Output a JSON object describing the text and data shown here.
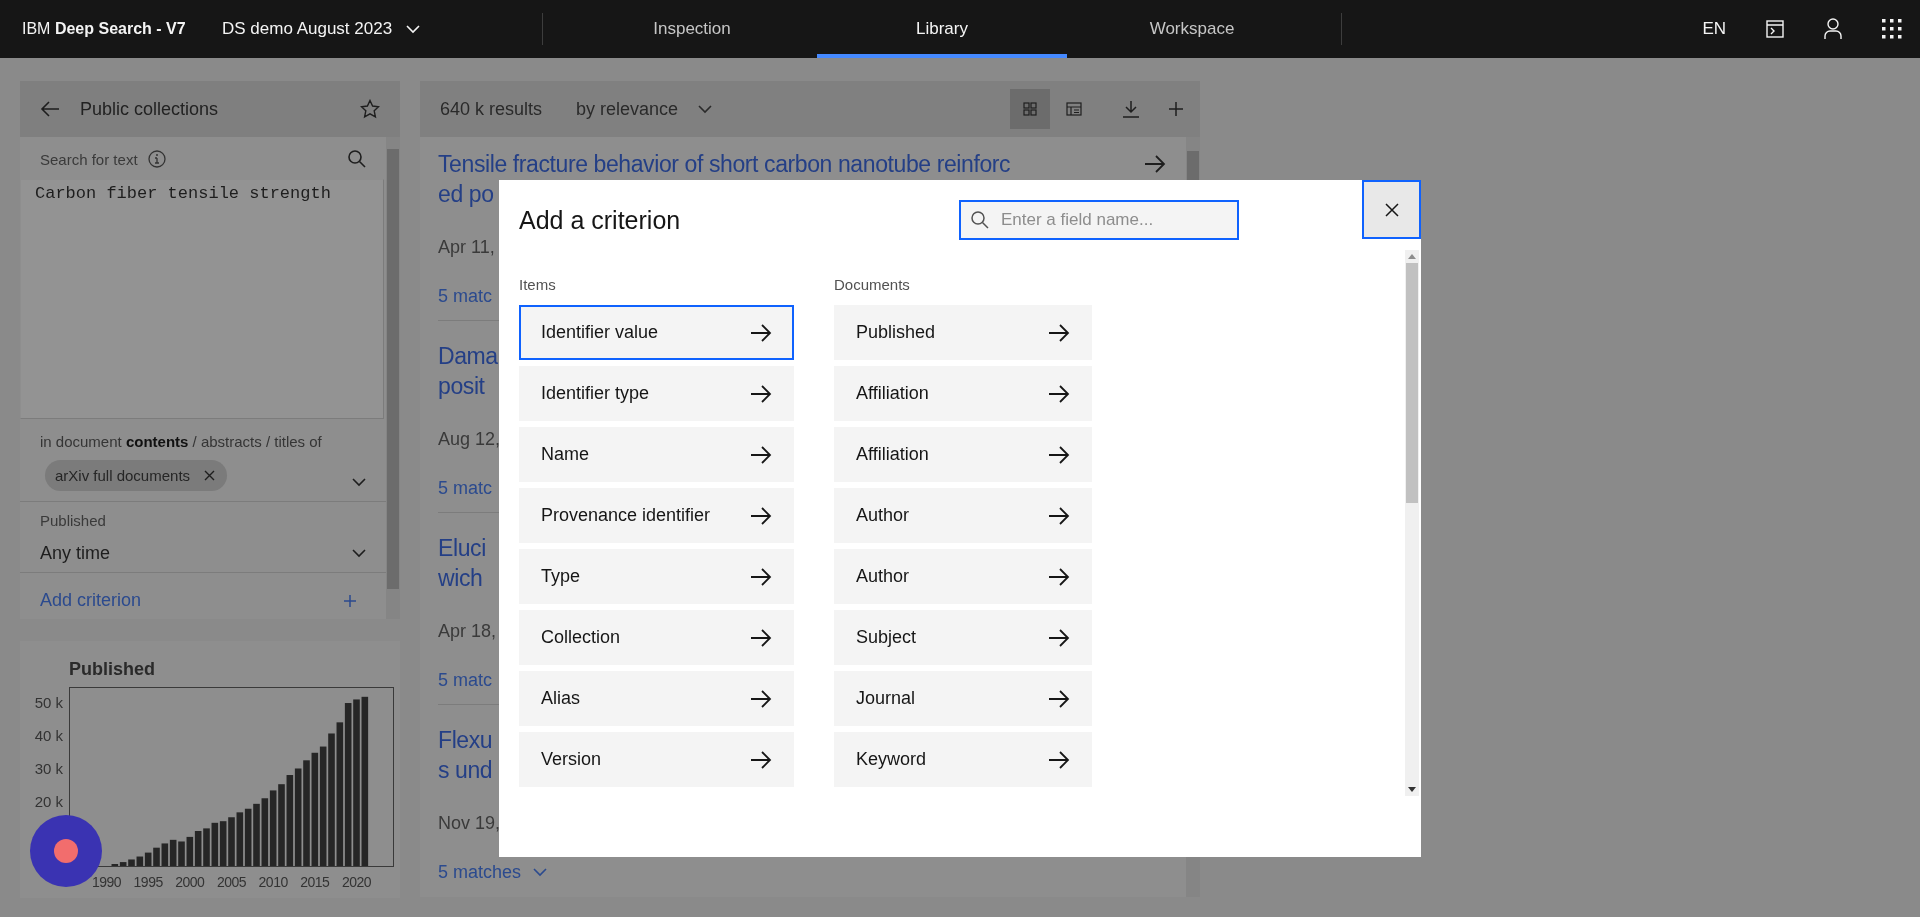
{
  "top_bar": {
    "brand": "IBM **Deep Search - V7**",
    "project": "DS demo August 2023",
    "tabs": [
      {
        "label": "Inspection",
        "selected": false
      },
      {
        "label": "Library",
        "selected": true
      },
      {
        "label": "Workspace",
        "selected": false
      }
    ],
    "language": "EN"
  },
  "collections_panel": {
    "title": "Public collections",
    "search_label": "Search for text",
    "query": "Carbon fiber tensile strength",
    "scope": "in document **contents** / abstracts / titles of",
    "collection_tag": "arXiv full documents",
    "published_label": "Published",
    "published_value": "Any time",
    "add_criterion": "Add criterion"
  },
  "published_chart": {
    "chart_data": {
      "type": "bar",
      "title": "Published",
      "x": [
        1991,
        1992,
        1993,
        1994,
        1995,
        1996,
        1997,
        1998,
        1999,
        2000,
        2001,
        2002,
        2003,
        2004,
        2005,
        2006,
        2007,
        2008,
        2009,
        2010,
        2011,
        2012,
        2013,
        2014,
        2015,
        2016,
        2017,
        2018,
        2019,
        2020,
        2021
      ],
      "series": [
        {
          "color": "#262626",
          "values": [
            400,
            1500,
            2300,
            3200,
            4400,
            5900,
            7200,
            8300,
            7800,
            9200,
            11000,
            11800,
            13500,
            14000,
            15200,
            16700,
            17800,
            19300,
            21000,
            23400,
            25300,
            28100,
            30100,
            32600,
            34900,
            36800,
            40800,
            44200,
            50100,
            51200,
            52000
          ]
        }
      ],
      "xlim": [
        1985.5,
        2024.5
      ],
      "ylim": [
        0,
        55000
      ],
      "xticks": [
        1990,
        1995,
        2000,
        2005,
        2010,
        2015,
        2020
      ],
      "yticks": [
        {
          "value": 20000,
          "label": "20 k"
        },
        {
          "value": 30000,
          "label": "30 k"
        },
        {
          "value": 40000,
          "label": "40 k"
        },
        {
          "value": 50000,
          "label": "50 k"
        }
      ]
    }
  },
  "results": {
    "count": "640 k results",
    "sort": "by relevance",
    "views": [
      {
        "kind": "grid",
        "selected": true
      },
      {
        "kind": "table",
        "selected": false
      }
    ],
    "entries": [
      {
        "title_lines": [
          "Tensile fracture behavior of short carbon nanotube reinforc",
          "ed po"
        ],
        "date": "Apr 11,",
        "matches": "5 matc",
        "caret": false
      },
      {
        "title_lines": [
          "Dama",
          "posit"
        ],
        "date": "Aug 12,",
        "matches": "5 matc",
        "caret": false
      },
      {
        "title_lines": [
          "Eluci",
          "wich"
        ],
        "date": "Apr 18,",
        "matches": "5 matc",
        "caret": false
      },
      {
        "title_lines": [
          "Flexu",
          "s und"
        ],
        "date": "Nov 19,",
        "matches": "5 matches",
        "caret": true
      }
    ]
  },
  "dialog": {
    "title": "Add a criterion",
    "search_placeholder": "Enter a field name...",
    "columns": [
      {
        "heading": "Items",
        "fields": [
          {
            "label": "Identifier value",
            "selected": true
          },
          {
            "label": "Identifier type",
            "selected": false
          },
          {
            "label": "Name",
            "selected": false
          },
          {
            "label": "Provenance identifier",
            "selected": false
          },
          {
            "label": "Type",
            "selected": false
          },
          {
            "label": "Collection",
            "selected": false
          },
          {
            "label": "Alias",
            "selected": false
          },
          {
            "label": "Version",
            "selected": false
          }
        ]
      },
      {
        "heading": "Documents",
        "fields": [
          {
            "label": "Published",
            "selected": false
          },
          {
            "label": "Affiliation",
            "selected": false
          },
          {
            "label": "Affiliation",
            "selected": false
          },
          {
            "label": "Author",
            "selected": false
          },
          {
            "label": "Author",
            "selected": false
          },
          {
            "label": "Subject",
            "selected": false
          },
          {
            "label": "Journal",
            "selected": false
          },
          {
            "label": "Keyword",
            "selected": false
          }
        ]
      }
    ]
  }
}
